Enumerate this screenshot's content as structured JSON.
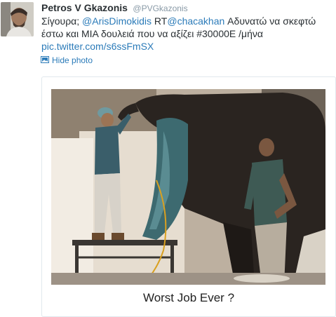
{
  "tweet": {
    "display_name": "Petros V Gkazonis",
    "screen_name": "@PVGkazonis",
    "text_prefix": "Σίγουρα; ",
    "mention_1": "@ArisDimokidis",
    "rt_label": " RT",
    "mention_2": "@chacakhan",
    "text_line1_rest": " Αδυνατώ να σκεφτώ",
    "text_line2": "έστω και ΜΙΑ δουλειά που να αξίζει #30000E /μήνα",
    "link": "pic.twitter.com/s6ssFmSX",
    "hide_photo_label": "Hide photo"
  },
  "media": {
    "caption": "Worst Job Ever ?"
  },
  "icons": {
    "hide_photo": "photo-icon"
  },
  "colors": {
    "link": "#2b7bb9",
    "name": "#292f33",
    "muted": "#8899a6"
  }
}
